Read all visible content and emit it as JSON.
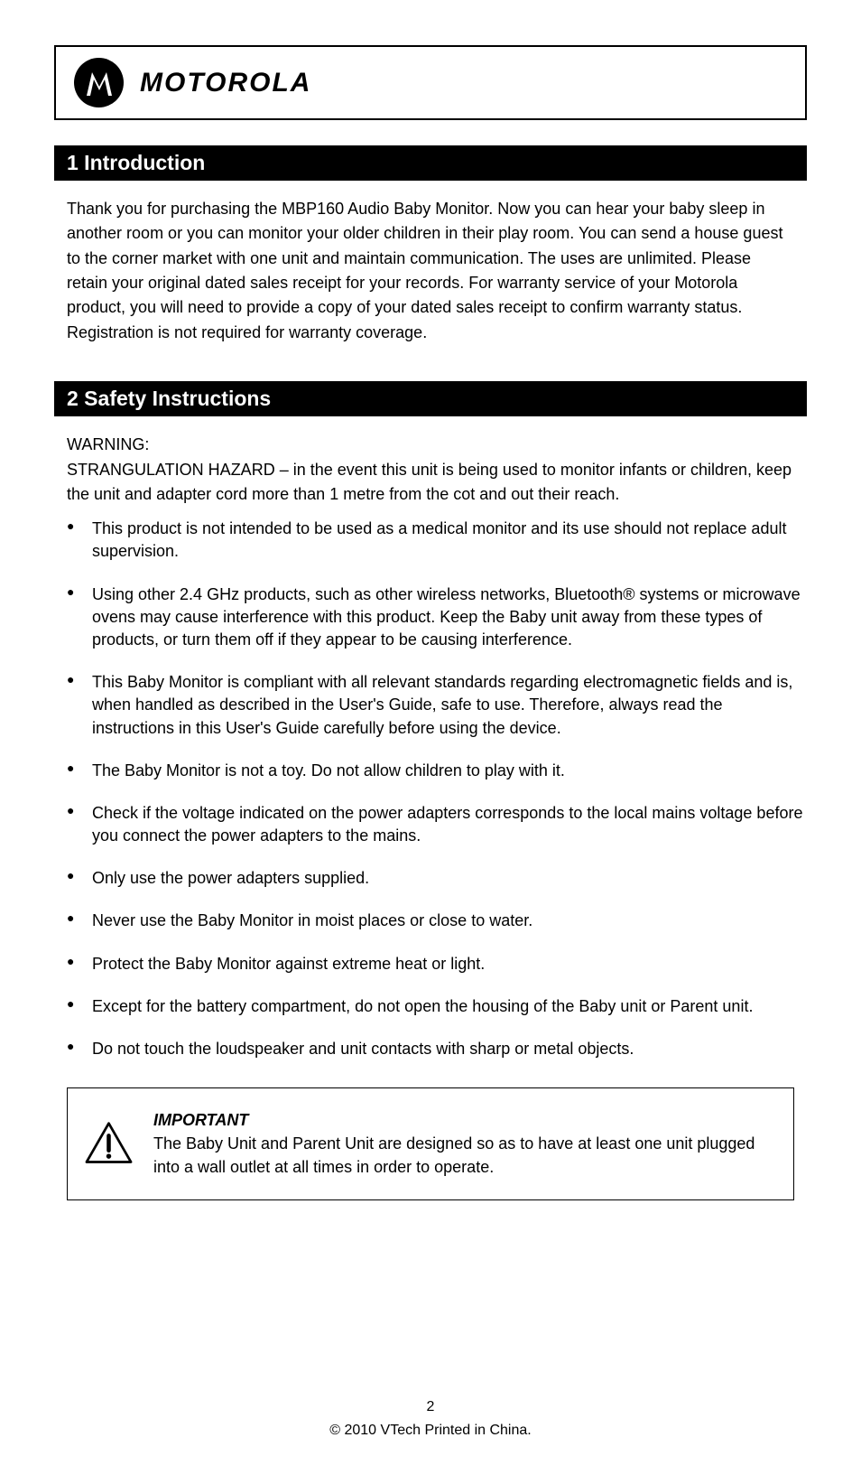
{
  "brand": "MOTOROLA",
  "section1": {
    "title": "1 Introduction",
    "para": "Thank you for purchasing the MBP160 Audio Baby Monitor. Now you can hear your baby sleep in another room or you can monitor your older children in their play room. You can send a house guest to the corner market with one unit and maintain communication. The uses are unlimited. Please retain your original dated sales receipt for your records. For warranty service of your Motorola product, you will need to provide a copy of your dated sales receipt to confirm warranty status. Registration is not required for warranty coverage."
  },
  "section2": {
    "title": "2 Safety Instructions",
    "intro_line1": "WARNING:",
    "intro_line2": "STRANGULATION HAZARD – in the event this unit is being used to monitor infants or children, keep the unit and adapter cord more than 1 metre from the cot and out their reach.",
    "bullets": [
      "This product is not intended to be used as a medical monitor and its use should not replace adult supervision.",
      "Using other 2.4 GHz products, such as other wireless networks, Bluetooth® systems or microwave ovens may cause interference with this product. Keep the Baby unit away from these types of products, or turn them off if they appear to be causing interference.",
      "This Baby Monitor is compliant with all relevant standards regarding electromagnetic fields and is, when handled as described in the User's Guide, safe to use. Therefore, always read the instructions in this User's Guide carefully before using the device.",
      "The Baby Monitor is not a toy. Do not allow children to play with it.",
      "Check if the voltage indicated on the power adapters corresponds to the local mains voltage before you connect the power adapters to the mains.",
      "Only use the power adapters supplied.",
      "Never use the Baby Monitor in moist places or close to water.",
      "Protect the Baby Monitor against extreme heat or light.",
      "Except for the battery compartment, do not open the housing of the Baby unit or Parent unit.",
      "Do not touch the loudspeaker and unit contacts with sharp or metal objects."
    ],
    "important_label": "IMPORTANT",
    "important_text": "The Baby Unit and Parent Unit are designed so as to have at least one unit plugged into a wall outlet at all times in order to operate."
  },
  "footer": {
    "page": "2",
    "copyright": "© 2010 VTech  Printed in China."
  }
}
